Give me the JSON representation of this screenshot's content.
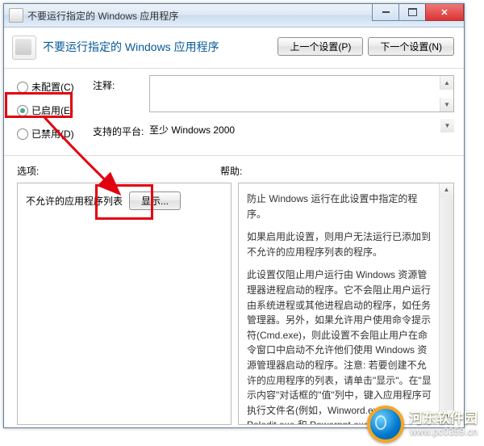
{
  "window": {
    "title": "不要运行指定的 Windows 应用程序",
    "btn_min": "minimize",
    "btn_max": "maximize",
    "btn_close": "close"
  },
  "header": {
    "heading": "不要运行指定的 Windows 应用程序",
    "prev_btn": "上一个设置(P)",
    "next_btn": "下一个设置(N)"
  },
  "config": {
    "radio_unconfigured": "未配置(C)",
    "radio_enabled": "已启用(E)",
    "radio_disabled": "已禁用(D)",
    "selected": "enabled",
    "comment_label": "注释:",
    "comment_value": "",
    "platform_label": "支持的平台:",
    "platform_value": "至少 Windows 2000"
  },
  "sections": {
    "options_label": "选项:",
    "help_label": "帮助:"
  },
  "options": {
    "disallowed_list_label": "不允许的应用程序列表",
    "show_button": "显示..."
  },
  "help": {
    "p1": "防止 Windows 运行在此设置中指定的程序。",
    "p2": "如果启用此设置，则用户无法运行已添加到不允许的应用程序列表的程序。",
    "p3": "此设置仅阻止用户运行由 Windows 资源管理器进程启动的程序。它不会阻止用户运行由系统进程或其他进程启动的程序，如任务管理器。另外，如果允许用户使用命令提示符(Cmd.exe)，则此设置不会阻止用户在命令窗口中启动不允许他们使用 Windows 资源管理器启动的程序。注意: 若要创建不允许的应用程序的列表，请单击\"显示\"。在\"显示内容\"对话框的\"值\"列中，键入应用程序可执行文件名(例如，Winword.exe、Poledit.exe 和 Powerpnt.exe)。"
  },
  "watermark": {
    "name": "河东软件园",
    "url": "www.pc0359.cn"
  }
}
